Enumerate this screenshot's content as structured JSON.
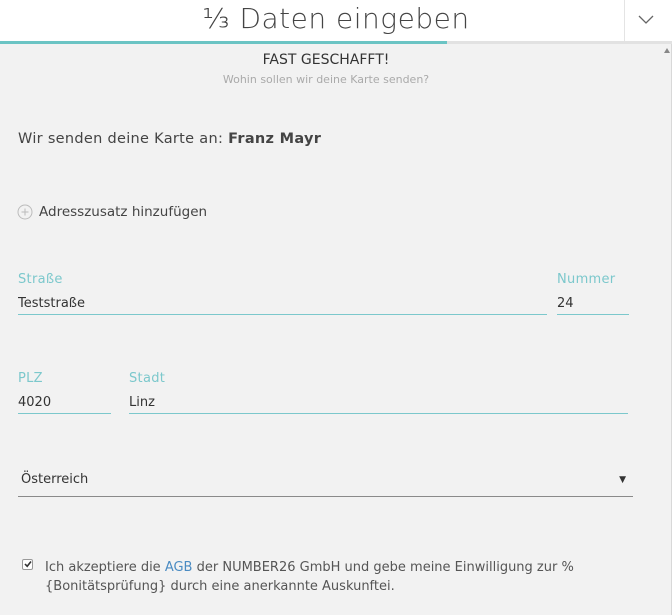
{
  "header": {
    "title": "⅓ Daten eingeben",
    "progress_fraction": 0.665
  },
  "step": {
    "title": "FAST GESCHAFFT!",
    "subtitle": "Wohin sollen wir deine Karte senden?"
  },
  "recipient": {
    "prefix": "Wir senden deine Karte an:",
    "name": "Franz Mayr"
  },
  "address_addition": {
    "label": "Adresszusatz hinzufügen",
    "icon": "plus-circle-icon"
  },
  "form": {
    "street": {
      "label": "Straße",
      "value": "Teststraße"
    },
    "number": {
      "label": "Nummer",
      "value": "24"
    },
    "zip": {
      "label": "PLZ",
      "value": "4020"
    },
    "city": {
      "label": "Stadt",
      "value": "Linz"
    },
    "country": {
      "value": "Österreich"
    }
  },
  "agb": {
    "checked": true,
    "text_before": "Ich akzeptiere die ",
    "link": "AGB",
    "text_after": " der NUMBER26 GmbH und gebe meine Einwilligung zur % {Bonitätsprüfung} durch eine anerkannte Auskunftei."
  },
  "colors": {
    "accent": "#6bc4c4",
    "link": "#4a8bc2",
    "background": "#f2f2f2"
  }
}
